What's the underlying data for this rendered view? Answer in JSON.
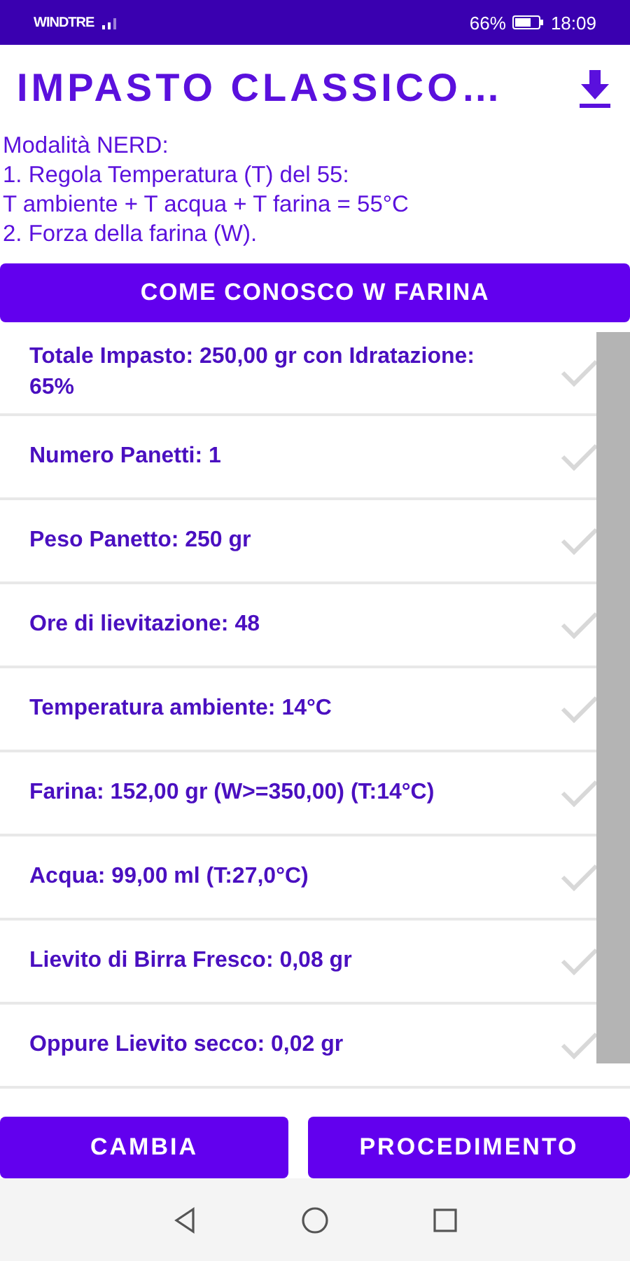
{
  "status_bar": {
    "carrier": "WINDTRE",
    "battery": "66%",
    "time": "18:09"
  },
  "title": "IMPASTO CLASSICO…",
  "info_lines": [
    "Modalità NERD:",
    "1. Regola Temperatura (T) del 55:",
    "T ambiente + T acqua + T farina = 55°C",
    "2. Forza della farina (W)."
  ],
  "info_button": "COME CONOSCO W FARINA",
  "items": [
    {
      "text": "Totale Impasto: 250,00 gr con Idratazione: 65%",
      "checked": false
    },
    {
      "text": "Numero Panetti: 1",
      "checked": false
    },
    {
      "text": "Peso Panetto: 250 gr",
      "checked": false
    },
    {
      "text": "Ore di lievitazione: 48",
      "checked": false
    },
    {
      "text": "Temperatura ambiente: 14°C",
      "checked": false
    },
    {
      "text": "Farina: 152,00 gr (W>=350,00) (T:14°C)",
      "checked": false
    },
    {
      "text": "Acqua: 99,00 ml (T:27,0°C)",
      "checked": false
    },
    {
      "text": "Lievito di Birra Fresco: 0,08 gr",
      "checked": false
    },
    {
      "text": "Oppure Lievito secco: 0,02 gr",
      "checked": false
    }
  ],
  "buttons": [
    "CAMBIA",
    "PROCEDIMENTO"
  ]
}
